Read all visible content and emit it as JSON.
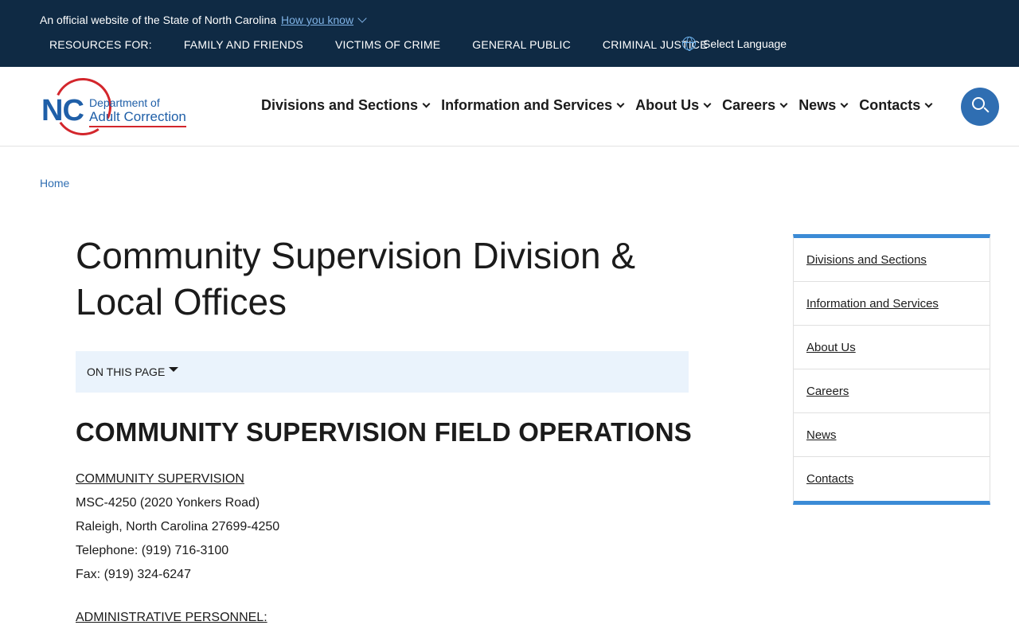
{
  "banner": {
    "official_text": "An official website of the State of North Carolina",
    "how_you_know": "How you know",
    "resources": [
      "RESOURCES FOR:",
      "FAMILY AND FRIENDS",
      "VICTIMS OF CRIME",
      "GENERAL PUBLIC",
      "CRIMINAL JUSTICE"
    ],
    "language": "Select Language"
  },
  "logo": {
    "nc": "NC",
    "line1": "Department of",
    "line2": "Adult Correction"
  },
  "nav": [
    "Divisions and Sections",
    "Information and Services",
    "About Us",
    "Careers",
    "News",
    "Contacts"
  ],
  "breadcrumb": "Home",
  "page": {
    "title": "Community Supervision Division & Local Offices",
    "on_this_page": "ON THIS PAGE",
    "section_heading": "COMMUNITY SUPERVISION FIELD OPERATIONS",
    "contact": {
      "heading": "COMMUNITY SUPERVISION",
      "address1": "MSC-4250 (2020 Yonkers Road)",
      "address2": "Raleigh, North Carolina 27699-4250",
      "telephone": "Telephone: (919) 716-3100",
      "fax": "Fax: (919) 324-6247"
    },
    "admin_heading": "ADMINISTRATIVE PERSONNEL:"
  },
  "sidebar": [
    "Divisions and Sections",
    "Information and Services",
    "About Us",
    "Careers",
    "News",
    "Contacts"
  ],
  "colors": {
    "banner_bg": "#0f2a44",
    "link_blue": "#2f6eb2",
    "sidebar_accent": "#3b8bd6",
    "on_this_page_bg": "#eaf3fc",
    "logo_red": "#d3262c"
  }
}
